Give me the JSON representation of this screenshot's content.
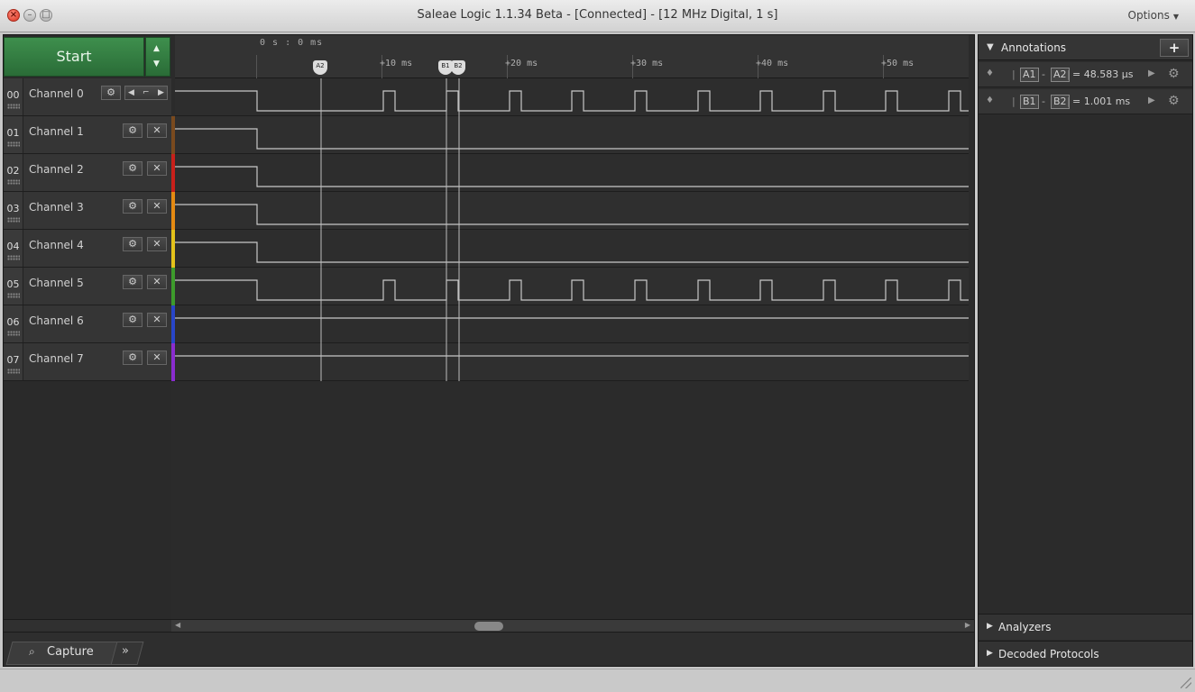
{
  "window": {
    "title": "Saleae Logic 1.1.34 Beta - [Connected] - [12 MHz Digital, 1 s]",
    "options_label": "Options",
    "close_glyph": "×",
    "minimize_glyph": "–",
    "maximize_glyph": "□"
  },
  "controls": {
    "start_label": "Start",
    "up_glyph": "▲",
    "down_glyph": "▼"
  },
  "channels": [
    {
      "num": "00",
      "name": "Channel 0",
      "color": "#2b2b2b"
    },
    {
      "num": "01",
      "name": "Channel 1",
      "color": "#7a4a1e"
    },
    {
      "num": "02",
      "name": "Channel 2",
      "color": "#c8201a"
    },
    {
      "num": "03",
      "name": "Channel 3",
      "color": "#e58a12"
    },
    {
      "num": "04",
      "name": "Channel 4",
      "color": "#e3c21a"
    },
    {
      "num": "05",
      "name": "Channel 5",
      "color": "#3d9b2b"
    },
    {
      "num": "06",
      "name": "Channel 6",
      "color": "#2845c8"
    },
    {
      "num": "07",
      "name": "Channel 7",
      "color": "#8a2ccf"
    }
  ],
  "channel_controls": {
    "gear_glyph": "⚙",
    "close_glyph": "✕",
    "trigger_left": "◀",
    "trigger_edge": "⌐",
    "trigger_right": "▶"
  },
  "timeline": {
    "origin_label": "0 s : 0 ms",
    "ticks": [
      "+10 ms",
      "+20 ms",
      "+30 ms",
      "+40 ms",
      "+50 ms"
    ],
    "markers": [
      "A2",
      "B1",
      "B2"
    ]
  },
  "annotations": {
    "header": "Annotations",
    "add_glyph": "+",
    "pin_glyph": "♦",
    "collapse_glyph": "▼",
    "play_glyph": "▶",
    "gear_glyph": "⚙",
    "rows": [
      {
        "from": "A1",
        "to": "A2",
        "value": "= 48.583 μs"
      },
      {
        "from": "B1",
        "to": "B2",
        "value": "= 1.001 ms"
      }
    ]
  },
  "side_sections": {
    "analyzers": "Analyzers",
    "decoded_protocols": "Decoded Protocols",
    "expand_glyph": "▶"
  },
  "bottom_tabs": {
    "capture_label": "Capture",
    "capture_icon": "⌕",
    "more_glyph": "»"
  },
  "scroll": {
    "left_glyph": "◀",
    "right_glyph": "▶"
  },
  "signal": {
    "periodic_channels": [
      0,
      5
    ],
    "step_low_channels": [
      1,
      2,
      3,
      4
    ],
    "flat_high_channels": [
      6,
      7
    ],
    "trace_color": "#c8c8c8"
  }
}
